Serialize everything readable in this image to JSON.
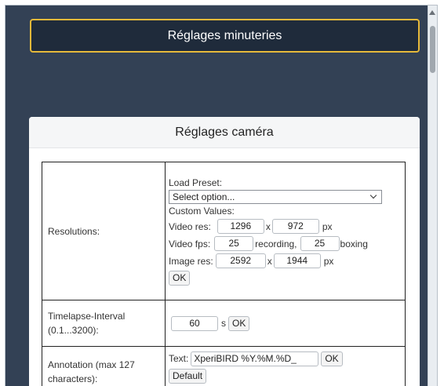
{
  "timers_button": "Réglages minuteries",
  "camera_panel": {
    "title": "Réglages caméra"
  },
  "resolutions": {
    "label": "Resolutions:",
    "load_preset_label": "Load Preset:",
    "preset_select_value": "Select option...",
    "custom_values_label": "Custom Values:",
    "video_res_label": "Video res:",
    "video_width": "1296",
    "video_height": "972",
    "x_sep": "x",
    "px_unit": "px",
    "video_fps_label": "Video fps:",
    "recording_fps": "25",
    "recording_label": "recording,",
    "boxing_fps": "25",
    "boxing_label": "boxing",
    "image_res_label": "Image res:",
    "image_width": "2592",
    "image_height": "1944",
    "ok_label": "OK"
  },
  "timelapse": {
    "label_line1": "Timelapse-Interval",
    "label_line2": "(0.1...3200):",
    "value": "60",
    "unit": "s",
    "ok_label": "OK"
  },
  "annotation": {
    "label_line1": "Annotation (max 127",
    "label_line2": "characters):",
    "text_label": "Text:",
    "text_value": "XperiBIRD %Y.%M.%D_",
    "ok_label": "OK",
    "default_label": "Default"
  }
}
